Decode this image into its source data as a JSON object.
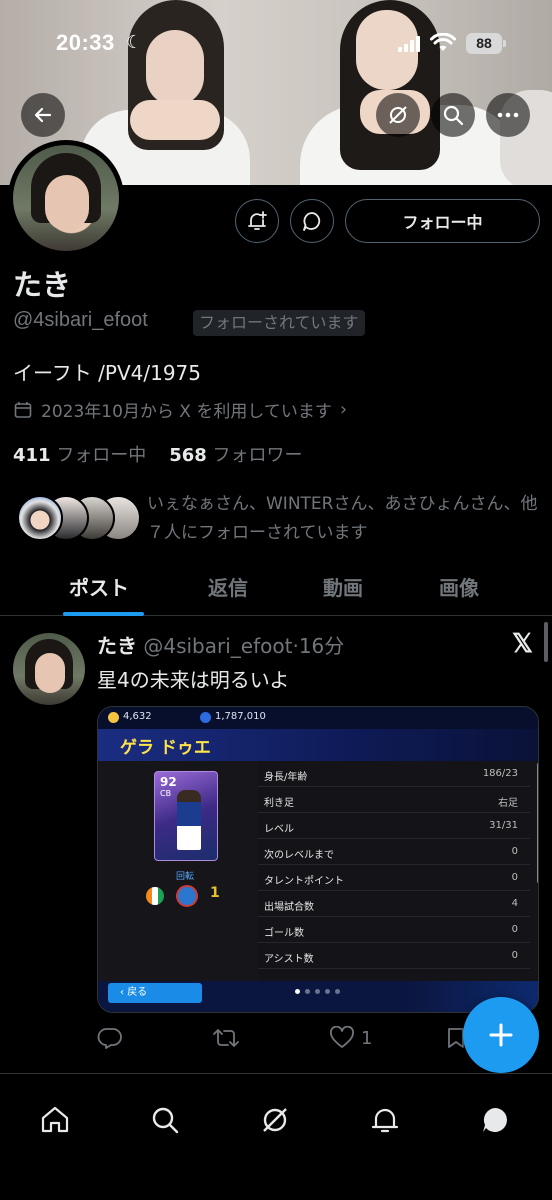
{
  "status_bar": {
    "time": "20:33",
    "battery": "88"
  },
  "profile": {
    "name": "たき",
    "handle": "@4sibari_efoot",
    "follows_you": "フォローされています",
    "bio": "イーフト /PV4/1975",
    "joined": "2023年10月から X を利用しています",
    "following_count": "411",
    "following_label": "フォロー中",
    "followers_count": "568",
    "followers_label": "フォロワー",
    "known_followers_text": "いぇなぁさん、WINTERさん、あさひょんさん、他７人にフォローされています",
    "follow_button": "フォロー中"
  },
  "tabs": [
    {
      "label": "ポスト",
      "active": true
    },
    {
      "label": "返信",
      "active": false
    },
    {
      "label": "動画",
      "active": false
    },
    {
      "label": "画像",
      "active": false
    }
  ],
  "post": {
    "name": "たき",
    "handle": "@4sibari_efoot",
    "time": "16分",
    "text": "星4の未来は明るいよ",
    "reply_count": "",
    "retweet_count": "",
    "like_count": "1",
    "media": {
      "coins": "4,632",
      "points": "1,787,010",
      "player_name": "ゲラ ドゥエ",
      "card_rating": "92",
      "card_position": "CB",
      "kaiten_label": "回転",
      "back_label": "戻る",
      "stats": [
        {
          "label": "身長/年齢",
          "value": "186/23"
        },
        {
          "label": "利き足",
          "value": "右足"
        },
        {
          "label": "レベル",
          "value": "31/31"
        },
        {
          "label": "次のレベルまで",
          "value": "0"
        },
        {
          "label": "タレントポイント",
          "value": "0"
        },
        {
          "label": "出場試合数",
          "value": "4"
        },
        {
          "label": "ゴール数",
          "value": "0"
        },
        {
          "label": "アシスト数",
          "value": "0"
        }
      ]
    }
  },
  "colors": {
    "accent": "#1d9bf0",
    "muted": "#71767b",
    "text": "#e7e9ea"
  }
}
